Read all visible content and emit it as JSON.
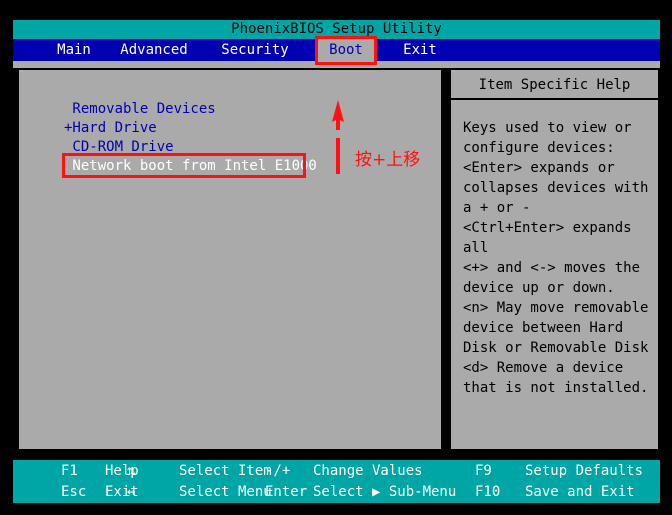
{
  "window": {
    "title": "PhoenixBIOS Setup Utility"
  },
  "menu": {
    "items": [
      {
        "label": "Main",
        "active": false
      },
      {
        "label": "Advanced",
        "active": false
      },
      {
        "label": "Security",
        "active": false
      },
      {
        "label": "Boot",
        "active": true
      },
      {
        "label": "Exit",
        "active": false
      }
    ]
  },
  "boot_list": {
    "items": [
      {
        "prefix": " ",
        "label": "Removable Devices",
        "selected": false
      },
      {
        "prefix": "+",
        "label": "Hard Drive",
        "selected": false
      },
      {
        "prefix": " ",
        "label": "CD-ROM Drive",
        "selected": false
      },
      {
        "prefix": " ",
        "label": "Network boot from Intel E1000",
        "selected": true
      }
    ]
  },
  "help": {
    "title": "Item Specific Help",
    "body": "Keys used to view or\nconfigure devices:\n<Enter> expands or\ncollapses devices with\na + or -\n<Ctrl+Enter> expands\nall\n<+> and <-> moves the\ndevice up or down.\n<n> May move removable\ndevice between Hard\nDisk or Removable Disk\n<d> Remove a device\nthat is not installed."
  },
  "status_bar": {
    "rows": [
      [
        {
          "key": "F1",
          "desc": "Help"
        },
        {
          "key": "⇅",
          "desc": "Select Item"
        },
        {
          "key": "-/+",
          "desc": "Change Values"
        },
        {
          "key": "F9",
          "desc": "Setup Defaults"
        }
      ],
      [
        {
          "key": "Esc",
          "desc": "Exit"
        },
        {
          "key": "↔",
          "desc": "Select Menu"
        },
        {
          "key": "Enter",
          "desc": "Select ▶ Sub-Menu"
        },
        {
          "key": "F10",
          "desc": "Save and Exit"
        }
      ]
    ]
  },
  "annotations": {
    "color": "#ff1111",
    "note_text": "按+上移",
    "arrow_direction": "up",
    "highlighted_tab": "Boot",
    "highlighted_row": "Network boot from Intel E1000"
  },
  "colors": {
    "title_bar": "#00a6a6",
    "menu_bar": "#0000b3",
    "panel": "#aaaaaa",
    "text_blue": "#0000b3",
    "status_bar": "#00a6a6",
    "annotation_red": "#ff1111",
    "background": "#000000"
  }
}
